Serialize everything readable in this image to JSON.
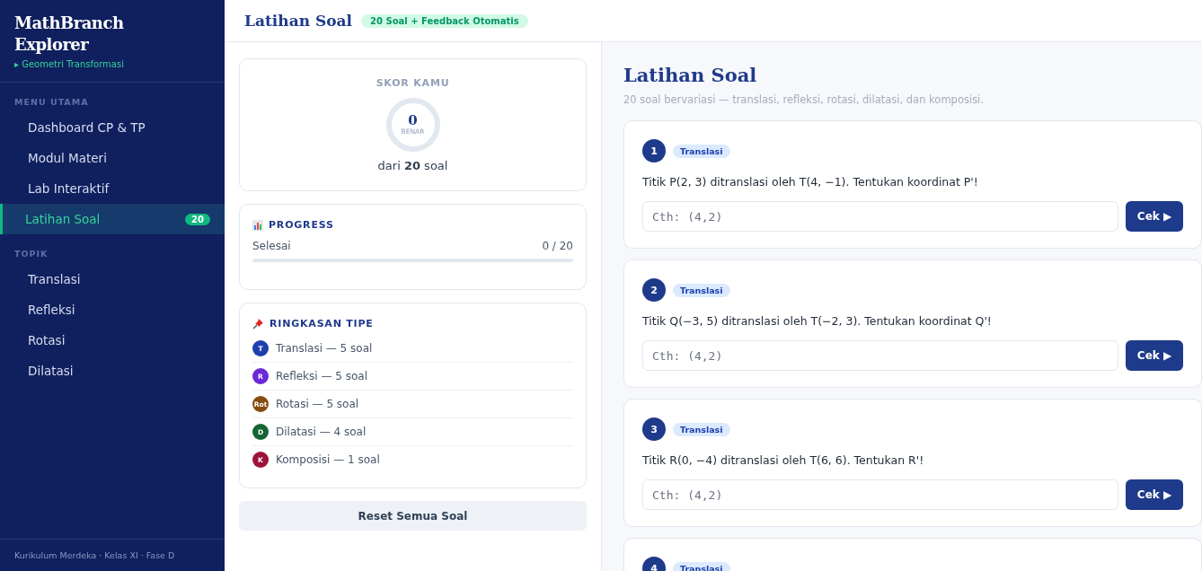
{
  "sidebar": {
    "brand": "MathBranch Explorer",
    "subtitle": "▸ Geometri Transformasi",
    "sections": [
      {
        "heading": "MENU UTAMA",
        "items": [
          {
            "label": "Dashboard CP & TP",
            "selected": false
          },
          {
            "label": "Modul Materi",
            "selected": false
          },
          {
            "label": "Lab Interaktif",
            "selected": false
          },
          {
            "label": "Latihan Soal",
            "selected": true,
            "badge": "20"
          }
        ]
      },
      {
        "heading": "TOPIK",
        "items": [
          {
            "label": "Translasi",
            "selected": false
          },
          {
            "label": "Refleksi",
            "selected": false
          },
          {
            "label": "Rotasi",
            "selected": false
          },
          {
            "label": "Dilatasi",
            "selected": false
          }
        ]
      }
    ],
    "footer": "Kurikulum Merdeka · Kelas XI · Fase D"
  },
  "topbar": {
    "title": "Latihan Soal",
    "badge": "20 Soal + Feedback Otomatis"
  },
  "score": {
    "heading": "SKOR KAMU",
    "value": "0",
    "unit": "BENAR",
    "summary": "dari **20** soal"
  },
  "progress": {
    "heading": "PROGRESS",
    "label": "Selesai",
    "reading": "0 / 20",
    "level": 0
  },
  "summary": {
    "heading": "RINGKASAN TIPE",
    "types": [
      {
        "letter": "T",
        "label": "Translasi — 5 soal",
        "color": "#1e40af"
      },
      {
        "letter": "R",
        "label": "Refleksi — 5 soal",
        "color": "#6d28d9"
      },
      {
        "letter": "Rot",
        "label": "Rotasi — 5 soal",
        "color": "#854d0e"
      },
      {
        "letter": "D",
        "label": "Dilatasi — 4 soal",
        "color": "#166534"
      },
      {
        "letter": "K",
        "label": "Komposisi — 1 soal",
        "color": "#9f1239"
      }
    ]
  },
  "reset_button": "Reset Semua Soal",
  "content": {
    "title": "Latihan Soal",
    "subtitle": "20 soal bervariasi — translasi, refleksi, rotasi, dilatasi, dan komposisi.",
    "questions": [
      {
        "number": "1",
        "tag": "Translasi",
        "text": "Titik P(2, 3) ditranslasi oleh T(4, −1). Tentukan koordinat P'!",
        "placeholder": "Cth: (4,2)",
        "button": "Cek ▶"
      },
      {
        "number": "2",
        "tag": "Translasi",
        "text": "Titik Q(−3, 5) ditranslasi oleh T(−2, 3). Tentukan koordinat Q'!",
        "placeholder": "Cth: (4,2)",
        "button": "Cek ▶"
      },
      {
        "number": "3",
        "tag": "Translasi",
        "text": "Titik R(0, −4) ditranslasi oleh T(6, 6). Tentukan R'!",
        "placeholder": "Cth: (4,2)",
        "button": "Cek ▶"
      },
      {
        "number": "4",
        "tag": "Translasi"
      }
    ]
  }
}
